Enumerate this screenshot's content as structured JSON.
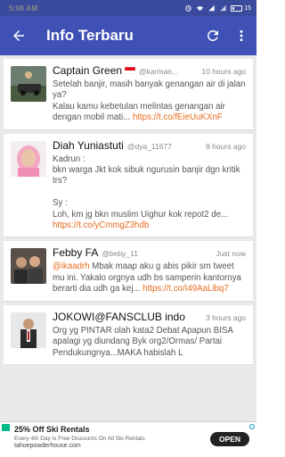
{
  "status_bar": {
    "time": "5:08 AM",
    "battery": "15",
    "battery_level": 0.15
  },
  "app_bar": {
    "title": "Info Terbaru",
    "back_icon": "arrow-back-icon",
    "refresh_icon": "refresh-icon",
    "menu_icon": "more-vert-icon"
  },
  "tweets": [
    {
      "name": "Captain Green",
      "handle": "@karman...",
      "time": "10 hours ago",
      "text": "Setelah banjir, masih banyak genangan air di jalan ya?\nKalau kamu kebetulan melintas genangan air dengan mobil mati... ",
      "link": "https://t.co/fEieUuKXnF",
      "has_flag": true
    },
    {
      "name": "Diah Yuniastuti",
      "handle": "@dya_11677",
      "time": "9 hours ago",
      "text": "Kadrun :\nbkn warga Jkt kok sibuk ngurusin banjir dgn kritik trs?\n\nSy :\nLoh, km jg bkn muslim Uighur kok repot2 de... ",
      "link": "https://t.co/yCmmgZ3hdb",
      "has_flag": false
    },
    {
      "name": "Febby FA",
      "handle": "@beby_11",
      "time": "Just now",
      "mention": "@ikaadrh",
      "text": " Mbak maap aku g abis pikir sm tweet mu ini. Yakalo orgnya udh bs samperin kantornya berarti dia udh ga kej... ",
      "link": "https://t.co/I49AaLibq7",
      "has_flag": false
    },
    {
      "name": "JOKOWI@FANSCLUB indo",
      "handle": "",
      "time": "3 hours ago",
      "text": "Org yg PINTAR olah kata2 Debat Apapun BISA apalagi yg diundang Byk org2/Ormas/ Partai Pendukungnya...MAKA habislah L",
      "link": "",
      "has_flag": false
    }
  ],
  "ad": {
    "title": "25% Off Ski Rentals",
    "subtitle": "Every 4th Day is Free Discounts On All Ski Rentals",
    "domain": "tahoepowderhouse.com",
    "button": "OPEN"
  }
}
